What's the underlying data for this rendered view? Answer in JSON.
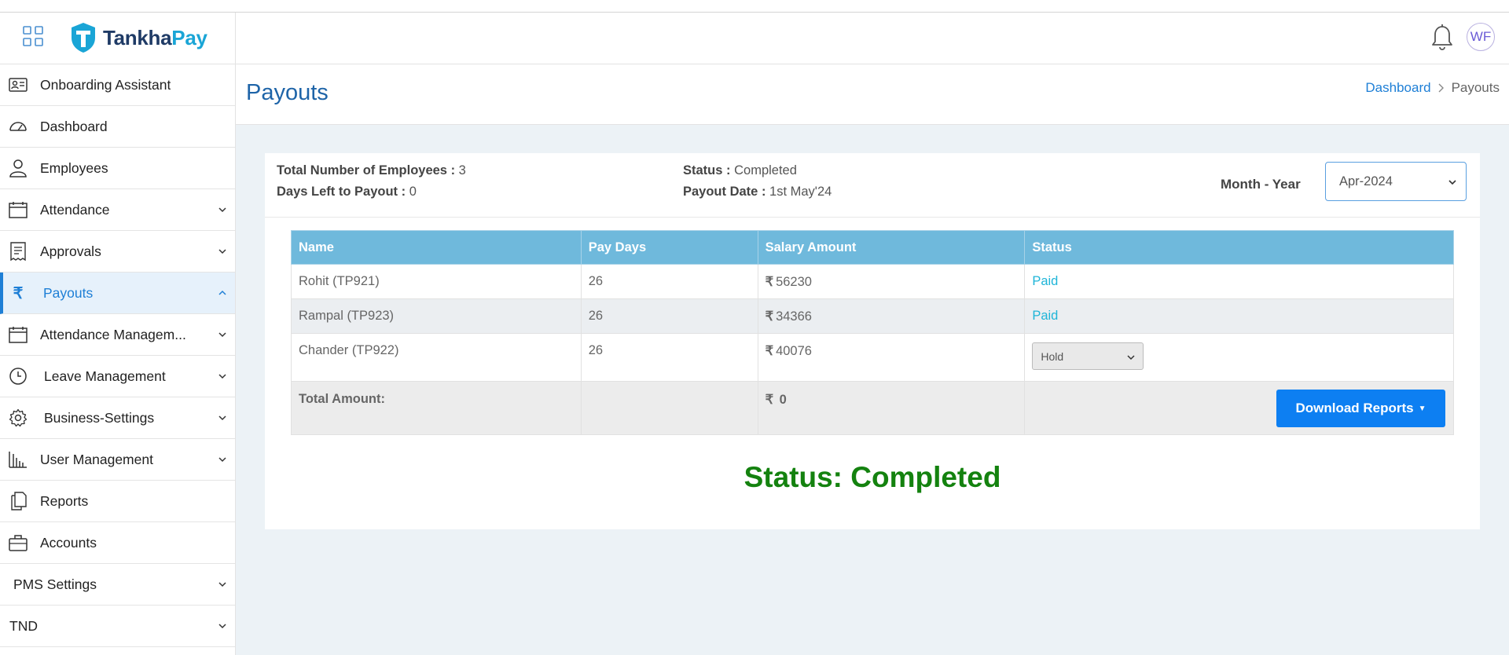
{
  "app": {
    "logo_text_1": "Tankha",
    "logo_text_2": "Pay",
    "avatar_initials": "WF"
  },
  "sidebar": {
    "items": [
      {
        "label": "Onboarding Assistant",
        "icon": "id-card-icon",
        "expandable": false
      },
      {
        "label": "Dashboard",
        "icon": "speedometer-icon",
        "expandable": false
      },
      {
        "label": "Employees",
        "icon": "user-icon",
        "expandable": false
      },
      {
        "label": "Attendance",
        "icon": "calendar-icon",
        "expandable": true
      },
      {
        "label": "Approvals",
        "icon": "receipt-icon",
        "expandable": true
      },
      {
        "label": "Payouts",
        "icon": "rupee-icon",
        "expandable": true,
        "active": true
      },
      {
        "label": "Attendance Managem...",
        "icon": "calendar-icon",
        "expandable": true
      },
      {
        "label": "Leave Management",
        "icon": "clock-icon",
        "expandable": true
      },
      {
        "label": "Business-Settings",
        "icon": "gear-icon",
        "expandable": true
      },
      {
        "label": "User Management",
        "icon": "bar-chart-icon",
        "expandable": true
      },
      {
        "label": "Reports",
        "icon": "document-icon",
        "expandable": false
      },
      {
        "label": "Accounts",
        "icon": "briefcase-icon",
        "expandable": false
      },
      {
        "label": "PMS Settings",
        "icon": "",
        "expandable": true
      },
      {
        "label": "TND",
        "icon": "",
        "expandable": true
      }
    ]
  },
  "page": {
    "title": "Payouts",
    "breadcrumb": {
      "home": "Dashboard",
      "current": "Payouts"
    }
  },
  "summary": {
    "total_employees_label": "Total Number of Employees :",
    "total_employees_value": "3",
    "days_left_label": "Days Left to Payout :",
    "days_left_value": "0",
    "status_label": "Status :",
    "status_value": "Completed",
    "payout_date_label": "Payout Date :",
    "payout_date_value": "1st May'24",
    "month_year_label": "Month - Year",
    "month_year_value": "Apr-2024"
  },
  "table": {
    "headers": [
      "Name",
      "Pay Days",
      "Salary Amount",
      "Status"
    ],
    "rows": [
      {
        "name": "Rohit (TP921)",
        "pay_days": "26",
        "salary": "56230",
        "status": "Paid"
      },
      {
        "name": "Rampal (TP923)",
        "pay_days": "26",
        "salary": "34366",
        "status": "Paid"
      },
      {
        "name": "Chander (TP922)",
        "pay_days": "26",
        "salary": "40076",
        "status": "Hold"
      }
    ],
    "total_label": "Total Amount:",
    "total_value": "0",
    "currency_symbol": "₹",
    "download_label": "Download Reports"
  },
  "status_banner": "Status: Completed",
  "colors": {
    "accent": "#1e7fd6",
    "table_header": "#6fb9dc",
    "paid": "#1fb5d8",
    "completed": "#14820f",
    "button": "#0d7ff2"
  }
}
